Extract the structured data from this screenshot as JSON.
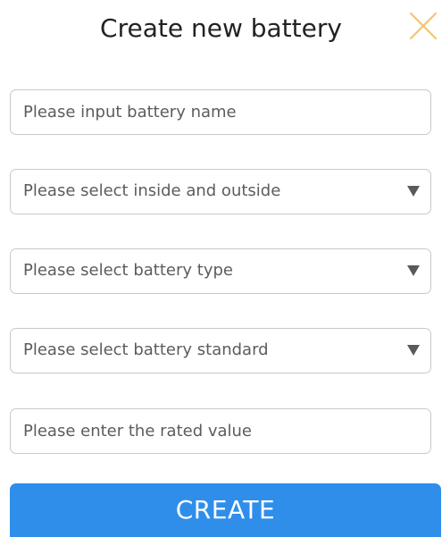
{
  "dialog": {
    "title": "Create new battery",
    "close_icon": "close-icon",
    "accent_color": "#2f8eea",
    "close_color": "#f3c56c"
  },
  "form": {
    "battery_name": {
      "placeholder": "Please input battery name",
      "value": ""
    },
    "inside_outside": {
      "placeholder": "Please select inside and outside",
      "icon": "dropdown-arrow-icon"
    },
    "battery_type": {
      "placeholder": "Please select battery type",
      "icon": "dropdown-arrow-icon"
    },
    "battery_standard": {
      "placeholder": "Please select battery standard",
      "icon": "dropdown-arrow-icon"
    },
    "rated_value": {
      "placeholder": "Please enter the rated value",
      "value": ""
    }
  },
  "actions": {
    "create_label": "CREATE"
  }
}
